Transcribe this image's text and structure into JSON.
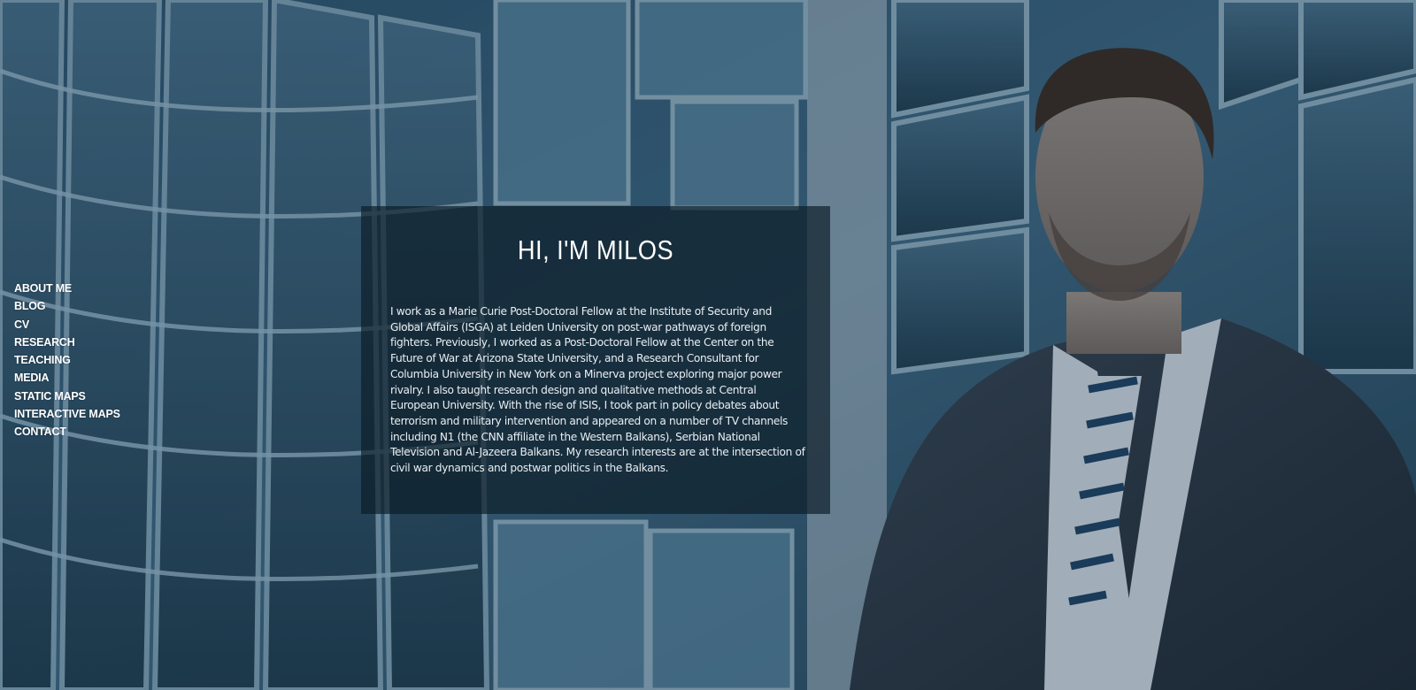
{
  "header": {
    "title": "HI, I'M MILOS"
  },
  "nav": {
    "items": [
      {
        "label": "ABOUT ME"
      },
      {
        "label": "BLOG"
      },
      {
        "label": "CV"
      },
      {
        "label": "RESEARCH"
      },
      {
        "label": "TEACHING"
      },
      {
        "label": "MEDIA"
      },
      {
        "label": "STATIC MAPS"
      },
      {
        "label": "INTERACTIVE MAPS"
      },
      {
        "label": "CONTACT"
      }
    ]
  },
  "main": {
    "bio": "I work as a Marie Curie Post-Doctoral Fellow at the Institute of Security and Global Affairs (ISGA) at Leiden University on post-war pathways of foreign fighters. Previously, I worked as a Post-Doctoral Fellow at the Center on the Future of War at Arizona State University, and a Research Consultant for Columbia University in New York on a Minerva project exploring major power rivalry. I also taught research design and qualitative methods at Central European University. With the rise of ISIS, I took part in policy debates about terrorism and military intervention and appeared on a number of TV channels including N1 (the CNN affiliate in the Western Balkans), Serbian National Television and Al-Jazeera Balkans. My research interests are at the intersection of civil war dynamics and postwar politics in the Balkans."
  },
  "colors": {
    "overlay": "#12283a",
    "panel": "#0c1c26",
    "text": "#ffffff"
  }
}
